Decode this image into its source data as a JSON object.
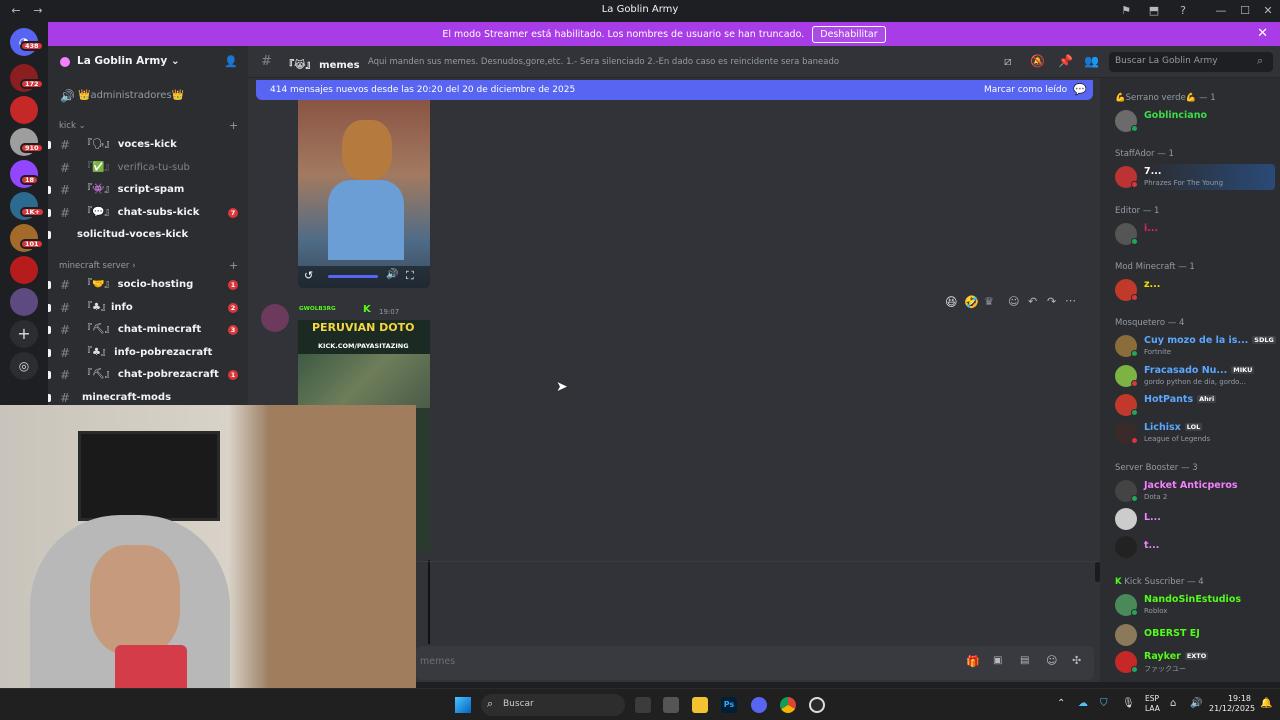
{
  "window": {
    "title": "La Goblin Army"
  },
  "banner": {
    "text": "El modo Streamer está habilitado. Los nombres de usuario se han truncado.",
    "button": "Deshabilitar"
  },
  "guild_badges": [
    "438",
    "172",
    "910",
    "18",
    "1K+",
    "101"
  ],
  "server": {
    "name": "La Goblin Army"
  },
  "sidebar": {
    "pinned": "👑administradores👑",
    "categories": [
      {
        "name": "kick",
        "items": [
          {
            "label": "voces-kick",
            "prefix": "『🗣』",
            "unread": true,
            "count": ""
          },
          {
            "label": "verifica-tu-sub",
            "prefix": "『✅』",
            "unread": false,
            "count": ""
          },
          {
            "label": "script-spam",
            "prefix": "『👾』",
            "unread": true,
            "count": ""
          },
          {
            "label": "chat-subs-kick",
            "prefix": "『💬』",
            "unread": true,
            "count": "7"
          },
          {
            "label": "solicitud-voces-kick",
            "prefix": "",
            "unread": true,
            "count": ""
          }
        ]
      },
      {
        "name": "minecraft server",
        "items": [
          {
            "label": "socio-hosting",
            "prefix": "『🤝』",
            "unread": true,
            "count": "1"
          },
          {
            "label": "info",
            "prefix": "『♣』",
            "unread": true,
            "count": "2"
          },
          {
            "label": "chat-minecraft",
            "prefix": "『⛏』",
            "unread": true,
            "count": "3"
          },
          {
            "label": "info-pobrezacraft",
            "prefix": "『♣』",
            "unread": true,
            "count": ""
          },
          {
            "label": "chat-pobrezacraft",
            "prefix": "『⛏』",
            "unread": true,
            "count": "1"
          },
          {
            "label": "minecraft-mods",
            "prefix": "",
            "unread": true,
            "count": ""
          }
        ]
      }
    ]
  },
  "channel": {
    "name": "memes",
    "prefix": "『😹』",
    "topic": "Aqui manden sus memes. Desnudos,gore,etc. 1.- Sera silenciado 2.-En dado caso es reincidente sera baneado"
  },
  "search": {
    "placeholder": "Buscar La Goblin Army"
  },
  "new_messages": {
    "text": "414 mensajes nuevos desde las 20:20 del 20 de diciembre de 2025",
    "mark_read": "Marcar como leído"
  },
  "message": {
    "author": "ᴳᵂᴼᴸᴮ³ᴿᴳ",
    "time": "19:07",
    "embed_title": "PERUVIAN DOTO",
    "embed_url": "KICK.COM/PAYASITAZING"
  },
  "composer": {
    "placeholder": "memes"
  },
  "members": {
    "groups": [
      {
        "title": "💪Serrano verde💪 — 1",
        "members": [
          {
            "name": "Goblinciano",
            "status": "",
            "tag": "",
            "color": "#3ddc4a"
          }
        ]
      },
      {
        "title": "StaffAdor — 1",
        "members": [
          {
            "name": "7...",
            "status": "Phrazes For The Young",
            "tag": "",
            "color": "#ffffff"
          }
        ]
      },
      {
        "title": "Editor — 1",
        "members": [
          {
            "name": "i...",
            "status": "",
            "tag": "",
            "color": "#e91e63"
          }
        ]
      },
      {
        "title": "Mod Minecraft — 1",
        "members": [
          {
            "name": "z...",
            "status": "",
            "tag": "",
            "color": "#f0e000"
          }
        ]
      },
      {
        "title": "Mosquetero — 4",
        "members": [
          {
            "name": "Cuy mozo de la is...",
            "status": "Fortnite",
            "tag": "SDLG",
            "color": "#5aa8ff"
          },
          {
            "name": "Fracasado Nu...",
            "status": "gordo python de día, gordo...",
            "tag": "MIKU",
            "color": "#5aa8ff"
          },
          {
            "name": "HotPants",
            "status": "",
            "tag": "Ahri",
            "color": "#5aa8ff"
          },
          {
            "name": "Lichisx",
            "status": "League of Legends",
            "tag": "LOL",
            "color": "#5aa8ff"
          }
        ]
      },
      {
        "title": "Server Booster — 3",
        "members": [
          {
            "name": "Jacket Anticperos",
            "status": "Dota 2",
            "tag": "",
            "color": "#f47fff"
          },
          {
            "name": "L...",
            "status": "",
            "tag": "",
            "color": "#f47fff"
          },
          {
            "name": "t...",
            "status": "",
            "tag": "",
            "color": "#f47fff"
          }
        ]
      },
      {
        "title": "Kick Suscriber — 4",
        "members": [
          {
            "name": "NandoSinEstudios",
            "status": "Roblox",
            "tag": "",
            "color": "#53fc18"
          },
          {
            "name": "OBERST EJ",
            "status": "",
            "tag": "",
            "color": "#53fc18"
          },
          {
            "name": "Rayker",
            "status": "ファックユー",
            "tag": "EXTO",
            "color": "#53fc18"
          }
        ]
      }
    ]
  },
  "taskbar": {
    "search": "Buscar",
    "lang": "ESP",
    "lang2": "LAA",
    "time": "19:18",
    "date": "21/12/2025"
  },
  "colors": {
    "accent": "#5865f2",
    "banner": "#a83ce6"
  }
}
